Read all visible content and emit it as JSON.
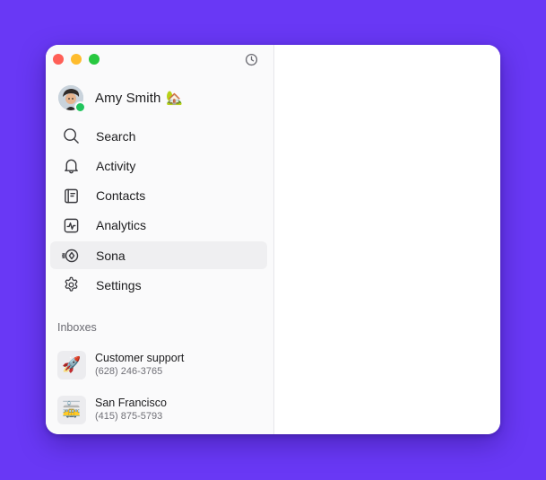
{
  "user": {
    "name": "Amy Smith",
    "status_emoji": "🏡",
    "presence_color": "#22c55e"
  },
  "nav": {
    "items": [
      {
        "label": "Search",
        "icon": "search-icon",
        "active": false
      },
      {
        "label": "Activity",
        "icon": "bell-icon",
        "active": false
      },
      {
        "label": "Contacts",
        "icon": "contacts-book-icon",
        "active": false
      },
      {
        "label": "Analytics",
        "icon": "analytics-chart-icon",
        "active": false
      },
      {
        "label": "Sona",
        "icon": "sona-target-icon",
        "active": true
      },
      {
        "label": "Settings",
        "icon": "gear-icon",
        "active": false
      }
    ]
  },
  "inboxes": {
    "title": "Inboxes",
    "items": [
      {
        "name": "Customer support",
        "phone": "(628) 246-3765",
        "emoji": "🚀"
      },
      {
        "name": "San Francisco",
        "phone": "(415) 875-5793",
        "emoji": "🚋"
      }
    ]
  },
  "colors": {
    "background": "#6938f5",
    "sidebar": "#fafafb",
    "active_item": "#efeff1"
  }
}
